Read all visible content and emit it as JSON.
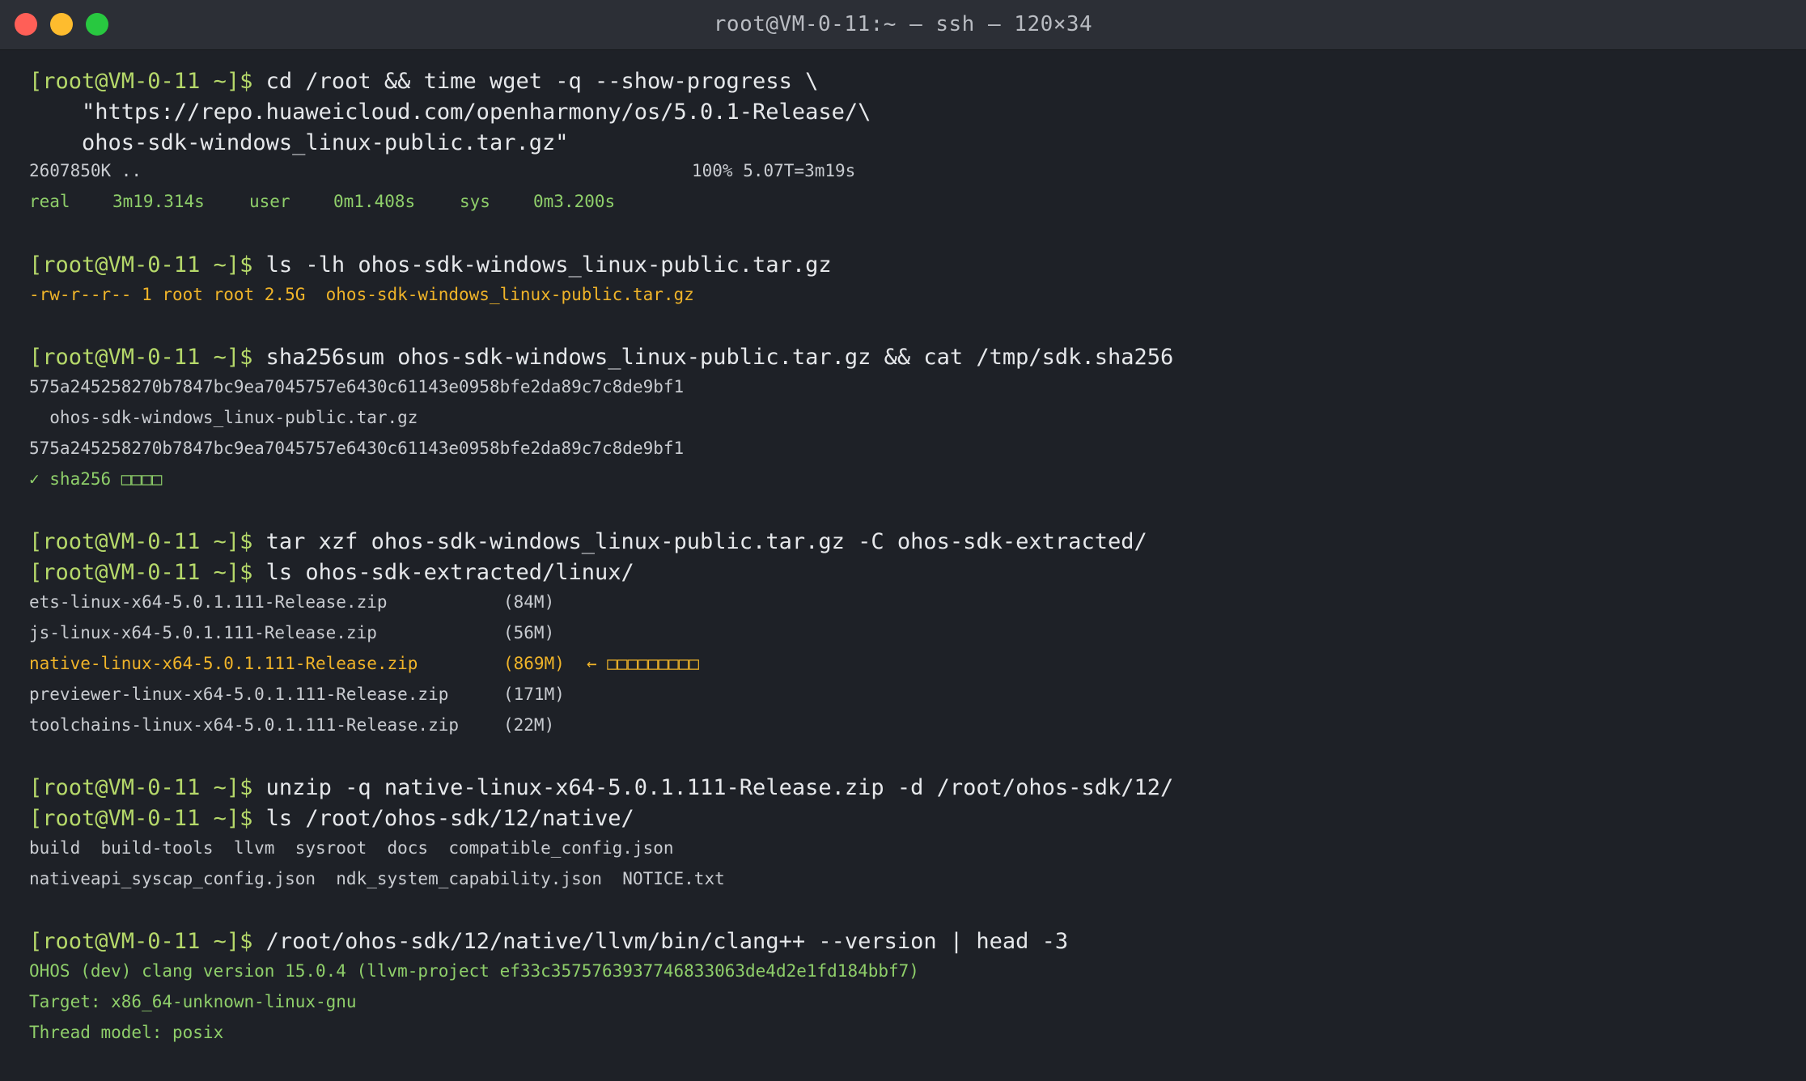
{
  "window": {
    "title": "root@VM-0-11:~ — ssh — 120×34"
  },
  "prompt": "[root@VM-0-11 ~]$",
  "blocks": {
    "wget": {
      "command": [
        "cd /root && time wget -q --show-progress \\",
        "    \"https://repo.huaweicloud.com/openharmony/os/5.0.1-Release/\\",
        "    ohos-sdk-windows_linux-public.tar.gz\""
      ],
      "progress_size": "2607850K ..",
      "progress_status": "100% 5.07T=3m19s",
      "timing": {
        "real_label": "real",
        "real_value": "3m19.314s",
        "user_label": "user",
        "user_value": "0m1.408s",
        "sys_label": "sys",
        "sys_value": "0m3.200s"
      }
    },
    "ls_archive": {
      "command": "ls -lh ohos-sdk-windows_linux-public.tar.gz",
      "output": "-rw-r--r-- 1 root root 2.5G  ohos-sdk-windows_linux-public.tar.gz"
    },
    "sha": {
      "command": "sha256sum ohos-sdk-windows_linux-public.tar.gz && cat /tmp/sdk.sha256",
      "output": [
        "575a245258270b7847bc9ea7045757e6430c61143e0958bfe2da89c7c8de9bf1",
        "  ohos-sdk-windows_linux-public.tar.gz",
        "575a245258270b7847bc9ea7045757e6430c61143e0958bfe2da89c7c8de9bf1"
      ],
      "check": "✓ sha256 □□□□"
    },
    "tar": {
      "command": "tar xzf ohos-sdk-windows_linux-public.tar.gz -C ohos-sdk-extracted/"
    },
    "ls_extracted": {
      "command": "ls ohos-sdk-extracted/linux/",
      "files": [
        {
          "name": "ets-linux-x64-5.0.1.111-Release.zip",
          "size": "(84M)",
          "note": ""
        },
        {
          "name": "js-linux-x64-5.0.1.111-Release.zip",
          "size": "(56M)",
          "note": ""
        },
        {
          "name": "native-linux-x64-5.0.1.111-Release.zip",
          "size": "(869M)",
          "note": "← □□□□□□□□□"
        },
        {
          "name": "previewer-linux-x64-5.0.1.111-Release.zip",
          "size": "(171M)",
          "note": ""
        },
        {
          "name": "toolchains-linux-x64-5.0.1.111-Release.zip",
          "size": "(22M)",
          "note": ""
        }
      ]
    },
    "unzip": {
      "command": "unzip -q native-linux-x64-5.0.1.111-Release.zip -d /root/ohos-sdk/12/"
    },
    "ls_native": {
      "command": "ls /root/ohos-sdk/12/native/",
      "output": [
        "build  build-tools  llvm  sysroot  docs  compatible_config.json",
        "nativeapi_syscap_config.json  ndk_system_capability.json  NOTICE.txt"
      ]
    },
    "clang": {
      "command": "/root/ohos-sdk/12/native/llvm/bin/clang++ --version | head -3",
      "output": [
        "OHOS (dev) clang version 15.0.4 (llvm-project ef33c3575763937746833063de4d2e1fd184bbf7)",
        "Target: x86_64-unknown-linux-gnu",
        "Thread model: posix"
      ]
    }
  },
  "colors": {
    "background": "#1e2127",
    "titlebar": "#2c2f36",
    "prompt": "#b6d96a",
    "green_output": "#8fcf6a",
    "highlight": "#f0b429",
    "text": "#c9ccd1"
  }
}
